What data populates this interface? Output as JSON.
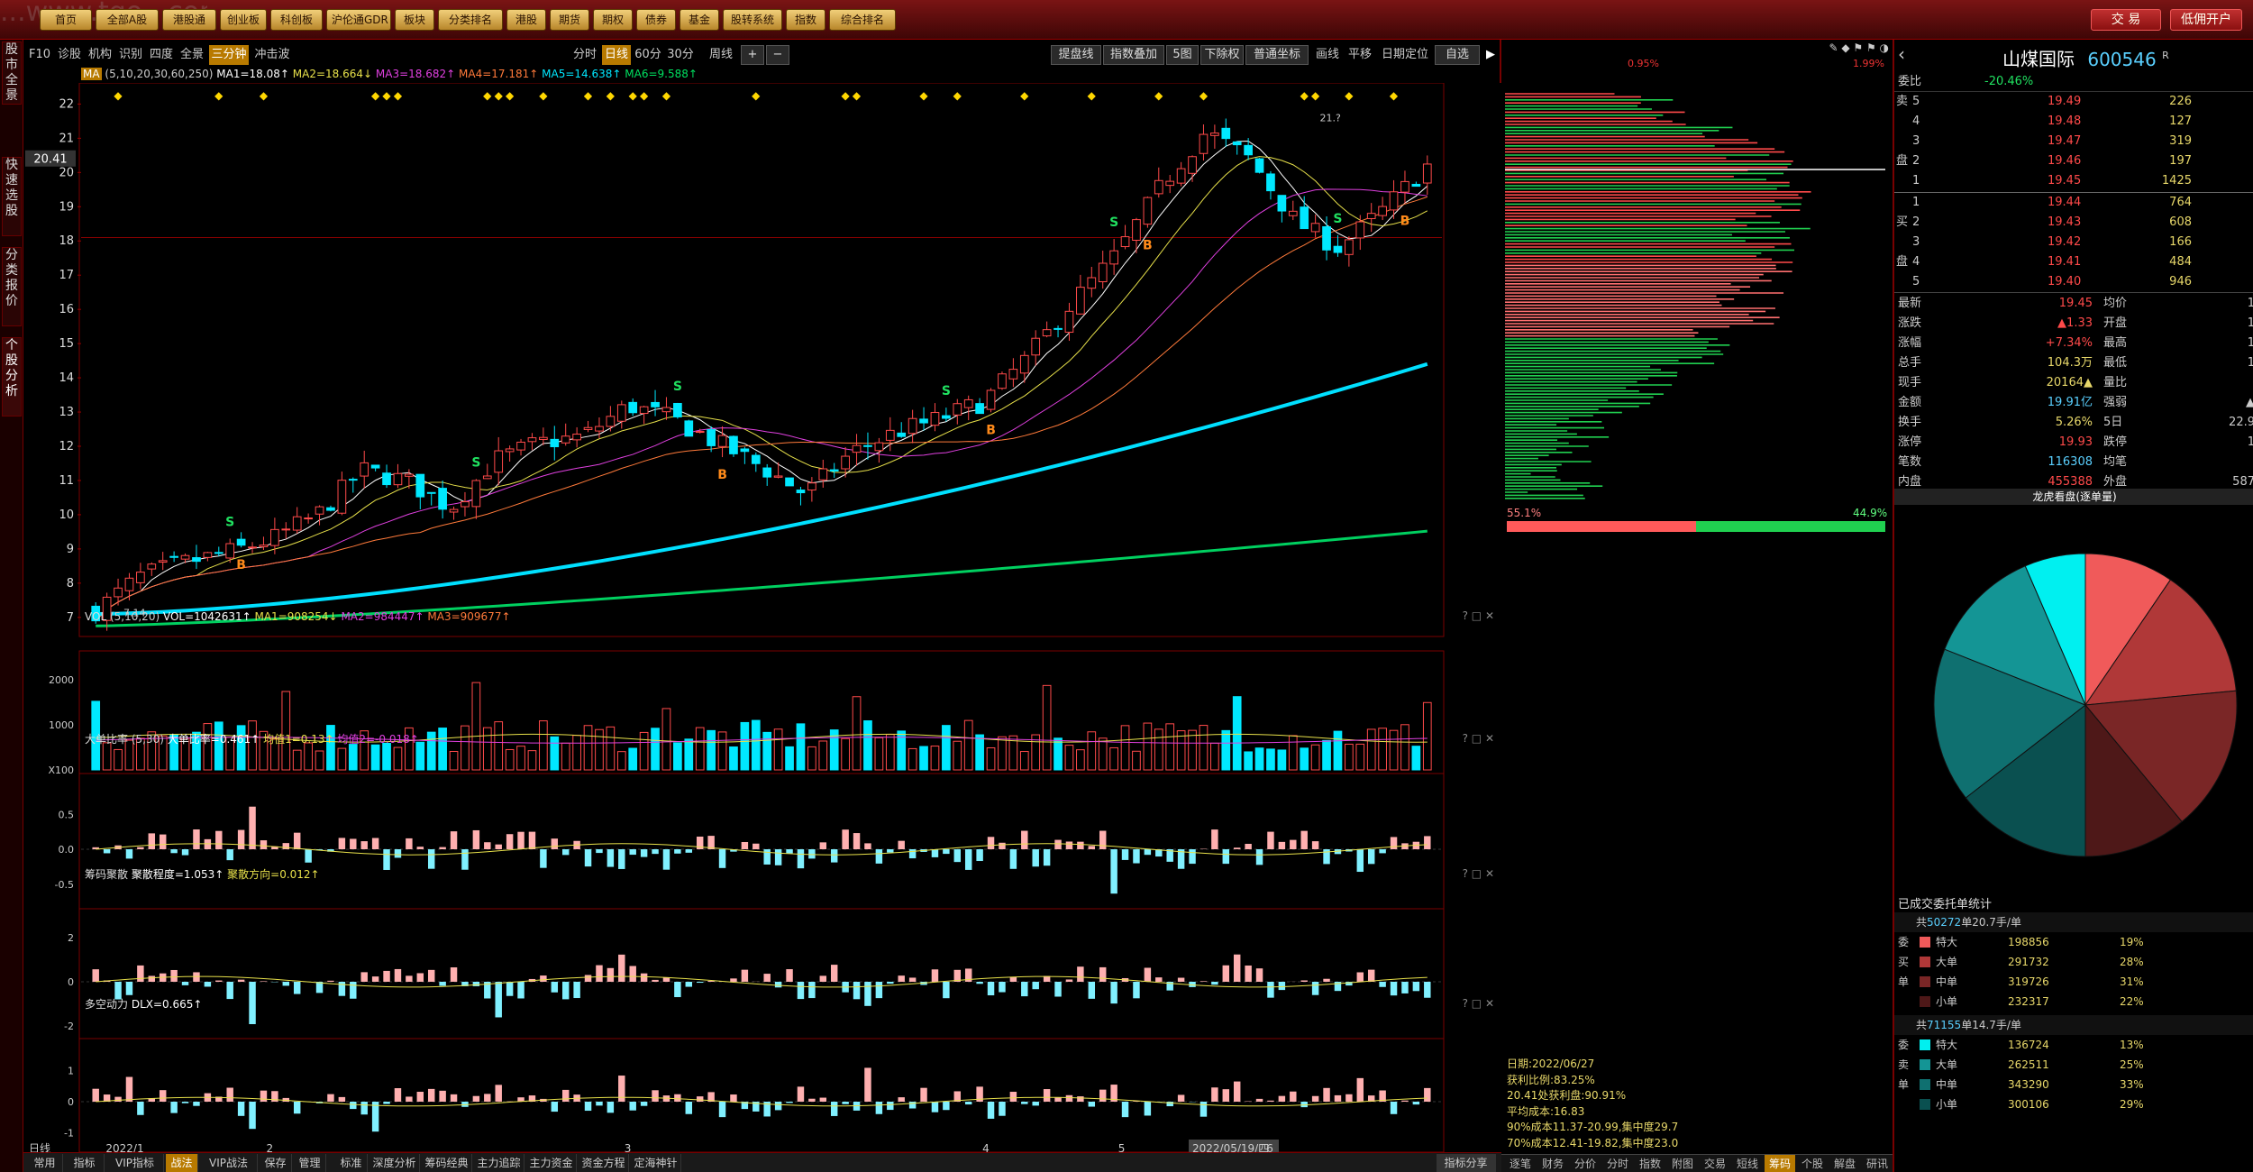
{
  "app": {
    "brand_text": "...www.tgo...com"
  },
  "top_menu": {
    "items": [
      "首页",
      "全部A股",
      "港股通",
      "创业板",
      "科创板",
      "沪伦通GDR",
      "板块",
      "分类排名",
      "港股",
      "期货",
      "期权",
      "债券",
      "基金",
      "股转系统",
      "指数",
      "综合排名"
    ],
    "trade_label": "交 易",
    "open_account_label": "低佣开户"
  },
  "left_strip": {
    "items": [
      "股市全景",
      "快速选股",
      "分类报价",
      "个股分析"
    ]
  },
  "toolbar": {
    "left": [
      "F10",
      "诊股",
      "机构",
      "识别",
      "四度",
      "全景",
      "三分钟",
      "冲击波"
    ],
    "periods": [
      "分时",
      "日线",
      "60分",
      "30分",
      "周线"
    ],
    "right": [
      "提盘线",
      "指数叠加",
      "5图",
      "下除权",
      "普通坐标",
      "画线",
      "平移",
      "日期定位",
      "自选"
    ]
  },
  "main_chart": {
    "ma_label": "MA",
    "ma_params": "(5,10,20,30,60,250)",
    "ma_values": [
      "MA1=18.08↑",
      "MA2=18.664↓",
      "MA3=18.682↑",
      "MA4=17.181↑",
      "MA5=14.638↑",
      "MA6=9.588↑"
    ],
    "price_ticks": [
      "22",
      "21",
      "20",
      "19",
      "18",
      "17",
      "16",
      "15",
      "14",
      "13",
      "12",
      "11",
      "10",
      "9",
      "8",
      "7"
    ],
    "current_price_label": "20.41",
    "low_label": "7.14",
    "high_label": "21.?",
    "buy_marker": "B",
    "sell_marker": "S"
  },
  "vol_panel": {
    "title": "VOL",
    "params": "(5,10,20)",
    "values": [
      "VOL=1042631↑",
      "MA1=908254↓",
      "MA2=984447↑",
      "MA3=909677↑"
    ],
    "ticks": [
      "2000",
      "1000",
      "X100"
    ]
  },
  "big_order_panel": {
    "title": "大单比率",
    "params": "(5,30)",
    "values": [
      "大单比率=0.461↑",
      "均值1=0.13↑",
      "均值2=-0.018↑"
    ],
    "ticks": [
      "0.5",
      "0.0",
      "-0.5"
    ]
  },
  "chip_panel": {
    "title": "筹码聚散",
    "values": [
      "聚散程度=1.053↑",
      "聚散方向=0.012↑"
    ],
    "ticks": [
      "2",
      "0",
      "-2"
    ]
  },
  "dlx_panel": {
    "title": "多空动力",
    "values": [
      "DLX=0.665↑"
    ],
    "ticks": [
      "1",
      "0",
      "-1"
    ]
  },
  "date_axis": {
    "period": "日线",
    "labels": [
      "2022/1",
      "2",
      "3",
      "4",
      "5",
      "2022/05/19/四",
      "6"
    ]
  },
  "bottom_tabs": [
    "常用",
    "指标",
    "VIP指标",
    "战法",
    "VIP战法",
    "保存",
    "管理",
    "标准",
    "深度分析",
    "筹码经典",
    "主力追踪",
    "主力资金",
    "资金方程",
    "定海神针"
  ],
  "bottom_right": "指标分享",
  "profile": {
    "top_left": "0.95%",
    "top_right": "1.99%",
    "pct_left": "55.1%",
    "pct_right": "44.9%",
    "info": [
      "日期:2022/06/27",
      "获利比例:83.25%",
      "20.41处获利盘:90.91%",
      "平均成本:16.83",
      "90%成本11.37-20.99,集中度29.7",
      "70%成本12.41-19.82,集中度23.0"
    ],
    "tabs": [
      "逐笔",
      "财务",
      "分价",
      "分时",
      "指数",
      "附图",
      "交易",
      "短线",
      "筹码",
      "个股",
      "解盘",
      "研讯"
    ]
  },
  "quote": {
    "name": "山煤国际",
    "code": "600546",
    "suffix": "R",
    "weibi_label": "委比",
    "weibi_value": "-20.46%",
    "weibi_extra": "",
    "asks": [
      {
        "side": "卖",
        "lv": "5",
        "price": "19.49",
        "vol": "226"
      },
      {
        "side": "",
        "lv": "4",
        "price": "19.48",
        "vol": "127"
      },
      {
        "side": "",
        "lv": "3",
        "price": "19.47",
        "vol": "319"
      },
      {
        "side": "盘",
        "lv": "2",
        "price": "19.46",
        "vol": "197"
      },
      {
        "side": "",
        "lv": "1",
        "price": "19.45",
        "vol": "1425"
      }
    ],
    "bids": [
      {
        "side": "",
        "lv": "1",
        "price": "19.44",
        "vol": "764"
      },
      {
        "side": "买",
        "lv": "2",
        "price": "19.43",
        "vol": "608"
      },
      {
        "side": "",
        "lv": "3",
        "price": "19.42",
        "vol": "166"
      },
      {
        "side": "盘",
        "lv": "4",
        "price": "19.41",
        "vol": "484"
      },
      {
        "side": "",
        "lv": "5",
        "price": "19.40",
        "vol": "946"
      }
    ],
    "stats": [
      {
        "l": "最新",
        "v": "19.45",
        "l2": "均价",
        "v2": "1"
      },
      {
        "l": "涨跌",
        "v": "▲1.33",
        "l2": "开盘",
        "v2": "1"
      },
      {
        "l": "涨幅",
        "v": "+7.34%",
        "l2": "最高",
        "v2": "1"
      },
      {
        "l": "总手",
        "v": "104.3万",
        "l2": "最低",
        "v2": "1"
      },
      {
        "l": "现手",
        "v": "20164▲",
        "l2": "量比",
        "v2": ""
      },
      {
        "l": "金额",
        "v": "19.91亿",
        "l2": "强弱",
        "v2": "▲"
      },
      {
        "l": "换手",
        "v": "5.26%",
        "l2": "5日",
        "v2": "22.9"
      },
      {
        "l": "涨停",
        "v": "19.93",
        "l2": "跌停",
        "v2": "1"
      },
      {
        "l": "笔数",
        "v": "116308",
        "l2": "均笔",
        "v2": ""
      },
      {
        "l": "内盘",
        "v": "455388",
        "l2": "外盘",
        "v2": "587"
      }
    ],
    "dragon_title": "龙虎看盘(逐单量)",
    "pie": [
      {
        "label": "特大",
        "value": 19,
        "color": "#f05a5a"
      },
      {
        "label": "大单",
        "value": 28,
        "color": "#b03838"
      },
      {
        "label": "中单",
        "value": 31,
        "color": "#7a2626"
      },
      {
        "label": "小单",
        "value": 22,
        "color": "#4e1818"
      },
      {
        "label": "小单",
        "value": 29,
        "color": "#0a5050"
      },
      {
        "label": "中单",
        "value": 33,
        "color": "#0f7070"
      },
      {
        "label": "大单",
        "value": 25,
        "color": "#149595"
      },
      {
        "label": "特大",
        "value": 13,
        "color": "#00f0f0"
      }
    ],
    "stats_title": "已成交委托单统计",
    "buy_header_pre": "共",
    "buy_header_num": "50272",
    "buy_header_post": "单20.7手/单",
    "buy_rows": [
      {
        "side": "委",
        "label": "特大",
        "vol": "198856",
        "pct": "19%",
        "color": "#f05a5a"
      },
      {
        "side": "买",
        "label": "大单",
        "vol": "291732",
        "pct": "28%",
        "color": "#b03838"
      },
      {
        "side": "单",
        "label": "中单",
        "vol": "319726",
        "pct": "31%",
        "color": "#7a2626"
      },
      {
        "side": "",
        "label": "小单",
        "vol": "232317",
        "pct": "22%",
        "color": "#4e1818"
      }
    ],
    "sell_header_pre": "共",
    "sell_header_num": "71155",
    "sell_header_post": "单14.7手/单",
    "sell_rows": [
      {
        "side": "委",
        "label": "特大",
        "vol": "136724",
        "pct": "13%",
        "color": "#00f0f0"
      },
      {
        "side": "卖",
        "label": "大单",
        "vol": "262511",
        "pct": "25%",
        "color": "#149595"
      },
      {
        "side": "单",
        "label": "中单",
        "vol": "343290",
        "pct": "33%",
        "color": "#0f7070"
      },
      {
        "side": "",
        "label": "小单",
        "vol": "300106",
        "pct": "29%",
        "color": "#0a5050"
      }
    ]
  }
}
